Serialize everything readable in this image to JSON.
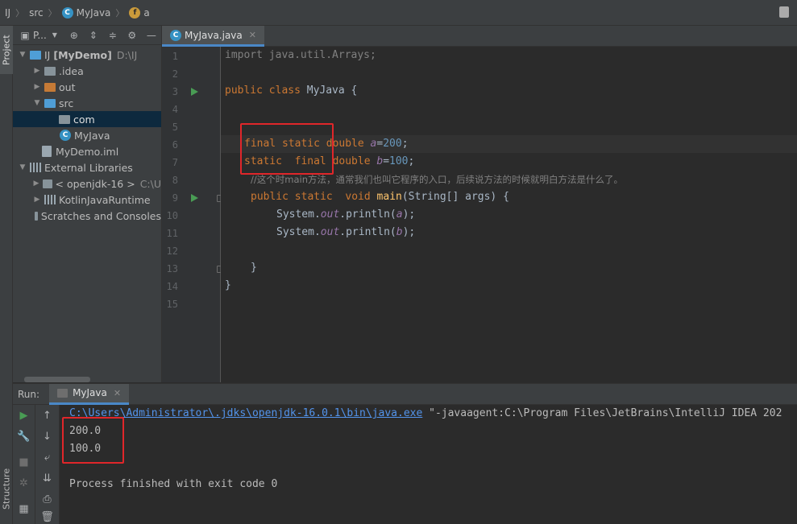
{
  "breadcrumb": {
    "items": [
      "IJ",
      "src",
      "MyJava",
      "a"
    ]
  },
  "left_strip": {
    "project_tab": "Project",
    "structure_tab": "Structure"
  },
  "project_panel": {
    "toolbar_label": "P...",
    "tree": [
      {
        "label": "IJ",
        "bold_label": "[MyDemo]",
        "path": "D:\\IJ"
      },
      {
        "label": ".idea"
      },
      {
        "label": "out"
      },
      {
        "label": "src"
      },
      {
        "label": "com"
      },
      {
        "label": "MyJava"
      },
      {
        "label": "MyDemo.iml"
      },
      {
        "label": "External Libraries"
      },
      {
        "label": "< openjdk-16 >",
        "path": "C:\\U"
      },
      {
        "label": "KotlinJavaRuntime"
      },
      {
        "label": "Scratches and Consoles"
      }
    ]
  },
  "editor": {
    "tab_label": "MyJava.java",
    "line_numbers": [
      "1",
      "2",
      "3",
      "4",
      "5",
      "6",
      "7",
      "8",
      "9",
      "10",
      "11",
      "12",
      "13",
      "14",
      "15"
    ],
    "comment_text": "//这个时main方法，通常我们也叫它程序的入口，后续说方法的时候就明白方法是什么了。"
  },
  "run_panel": {
    "label": "Run:",
    "tab_label": "MyJava",
    "command_link": "C:\\Users\\Administrator\\.jdks\\openjdk-16.0.1\\bin\\java.exe",
    "command_rest": " \"-javaagent:C:\\Program Files\\JetBrains\\IntelliJ IDEA 202",
    "output": [
      "200.0",
      "100.0"
    ],
    "exit_message": "Process finished with exit code 0"
  },
  "colors": {
    "background": "#2b2b2b",
    "keyword": "#cc7832",
    "field": "#9876aa",
    "number": "#6897bb",
    "function": "#ffc66d",
    "highlight_box": "#e0262a",
    "link": "#5394ec"
  }
}
